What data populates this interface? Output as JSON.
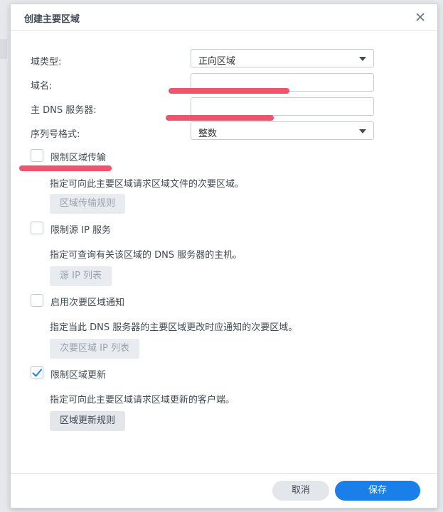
{
  "dialog": {
    "title": "创建主要区域"
  },
  "fields": {
    "zone_type": {
      "label": "域类型:",
      "value": "正向区域"
    },
    "domain_name": {
      "label": "域名:",
      "value": ""
    },
    "primary_dns": {
      "label": "主 DNS 服务器:",
      "value": ""
    },
    "serial_format": {
      "label": "序列号格式:",
      "value": "整数"
    }
  },
  "options": [
    {
      "label": "限制区域传输",
      "checked": false,
      "description": "指定可向此主要区域请求区域文件的次要区域。",
      "button": "区域传输规则",
      "button_enabled": false
    },
    {
      "label": "限制源 IP 服务",
      "checked": false,
      "description": "指定可查询有关该区域的 DNS 服务器的主机。",
      "button": "源 IP 列表",
      "button_enabled": false
    },
    {
      "label": "启用次要区域通知",
      "checked": false,
      "description": "指定当此 DNS 服务器的主要区域更改时应通知的次要区域。",
      "button": "次要区域 IP 列表",
      "button_enabled": false
    },
    {
      "label": "限制区域更新",
      "checked": true,
      "description": "指定可向此主要区域请求区域更新的客户端。",
      "button": "区域更新规则",
      "button_enabled": true
    }
  ],
  "footer": {
    "cancel_label": "取消",
    "save_label": "保存"
  },
  "colors": {
    "accent": "#1a7fe8",
    "redaction": "#f0546c"
  },
  "icons": {
    "close": "close-icon",
    "dropdown": "caret-down-icon",
    "check": "checkmark-icon"
  }
}
